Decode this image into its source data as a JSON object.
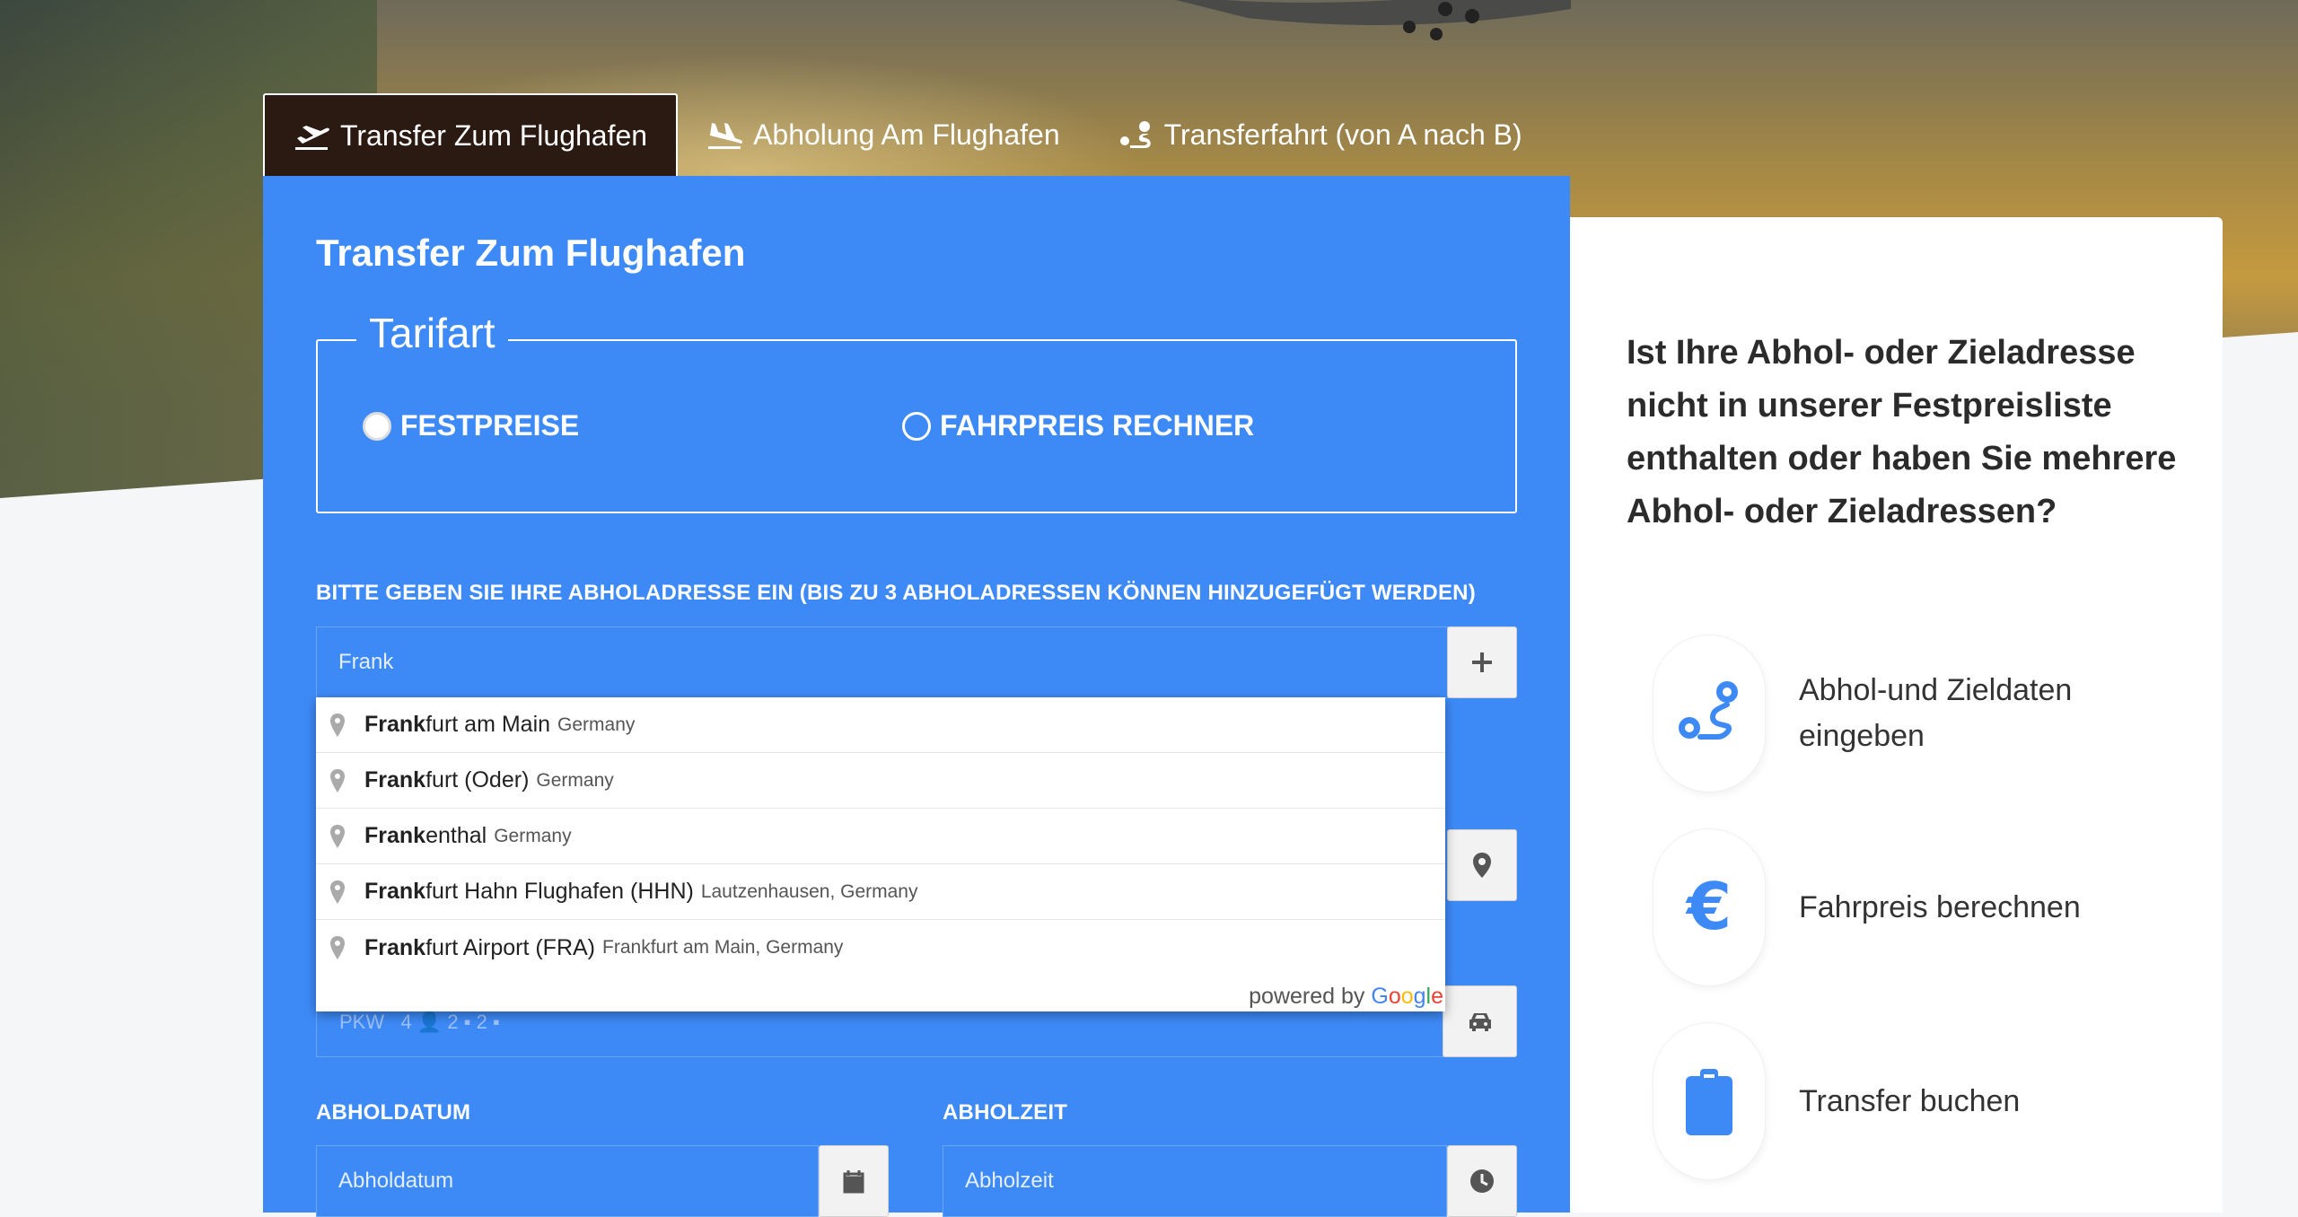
{
  "tabs": [
    {
      "label": "Transfer Zum Flughafen",
      "icon": "plane-departure-icon",
      "active": true
    },
    {
      "label": "Abholung Am Flughafen",
      "icon": "plane-arrival-icon",
      "active": false
    },
    {
      "label": "Transferfahrt (von A nach B)",
      "icon": "route-icon",
      "active": false
    }
  ],
  "form": {
    "title": "Transfer Zum Flughafen",
    "tarifart": {
      "legend": "Tarifart",
      "options": [
        {
          "label": "FESTPREISE",
          "selected": true
        },
        {
          "label": "FAHRPREIS RECHNER",
          "selected": false
        }
      ]
    },
    "pickup": {
      "label": "BITTE GEBEN SIE IHRE ABHOLADRESSE EIN (BIS ZU 3 ABHOLADRESSEN KÖNNEN HINZUGEFÜGT WERDEN)",
      "value": "Frank",
      "add_icon": "plus-icon"
    },
    "suggestions": [
      {
        "match": "Frank",
        "rest": "furt am Main",
        "secondary": "Germany"
      },
      {
        "match": "Frank",
        "rest": "furt (Oder)",
        "secondary": "Germany"
      },
      {
        "match": "Frank",
        "rest": "enthal",
        "secondary": "Germany"
      },
      {
        "match": "Frank",
        "rest": "furt Hahn Flughafen (HHN)",
        "secondary": "Lautzenhausen, Germany"
      },
      {
        "match": "Frank",
        "rest": "furt Airport (FRA)",
        "secondary": "Frankfurt am Main, Germany"
      }
    ],
    "powered_by": "powered by",
    "google": [
      "G",
      "o",
      "o",
      "g",
      "l",
      "e"
    ],
    "vehicle": {
      "text": "PKW",
      "persons": "4",
      "bags": "2",
      "hand": "2"
    },
    "date": {
      "label": "ABHOLDATUM",
      "placeholder": "Abholdatum"
    },
    "time": {
      "label": "ABHOLZEIT",
      "placeholder": "Abholzeit"
    }
  },
  "side": {
    "heading": "Ist Ihre Abhol- oder Zieladresse nicht in unserer Festpreisliste enthalten oder haben Sie mehrere Abhol- oder Zieladressen?",
    "steps": [
      {
        "text": "Abhol-und Zieldaten eingeben",
        "icon": "route-icon"
      },
      {
        "text": "Fahrpreis berechnen",
        "icon": "euro-icon"
      },
      {
        "text": "Transfer buchen",
        "icon": "clipboard-icon"
      }
    ]
  },
  "colors": {
    "primary": "#3d8af7",
    "tab_active": "#2a1a12"
  }
}
